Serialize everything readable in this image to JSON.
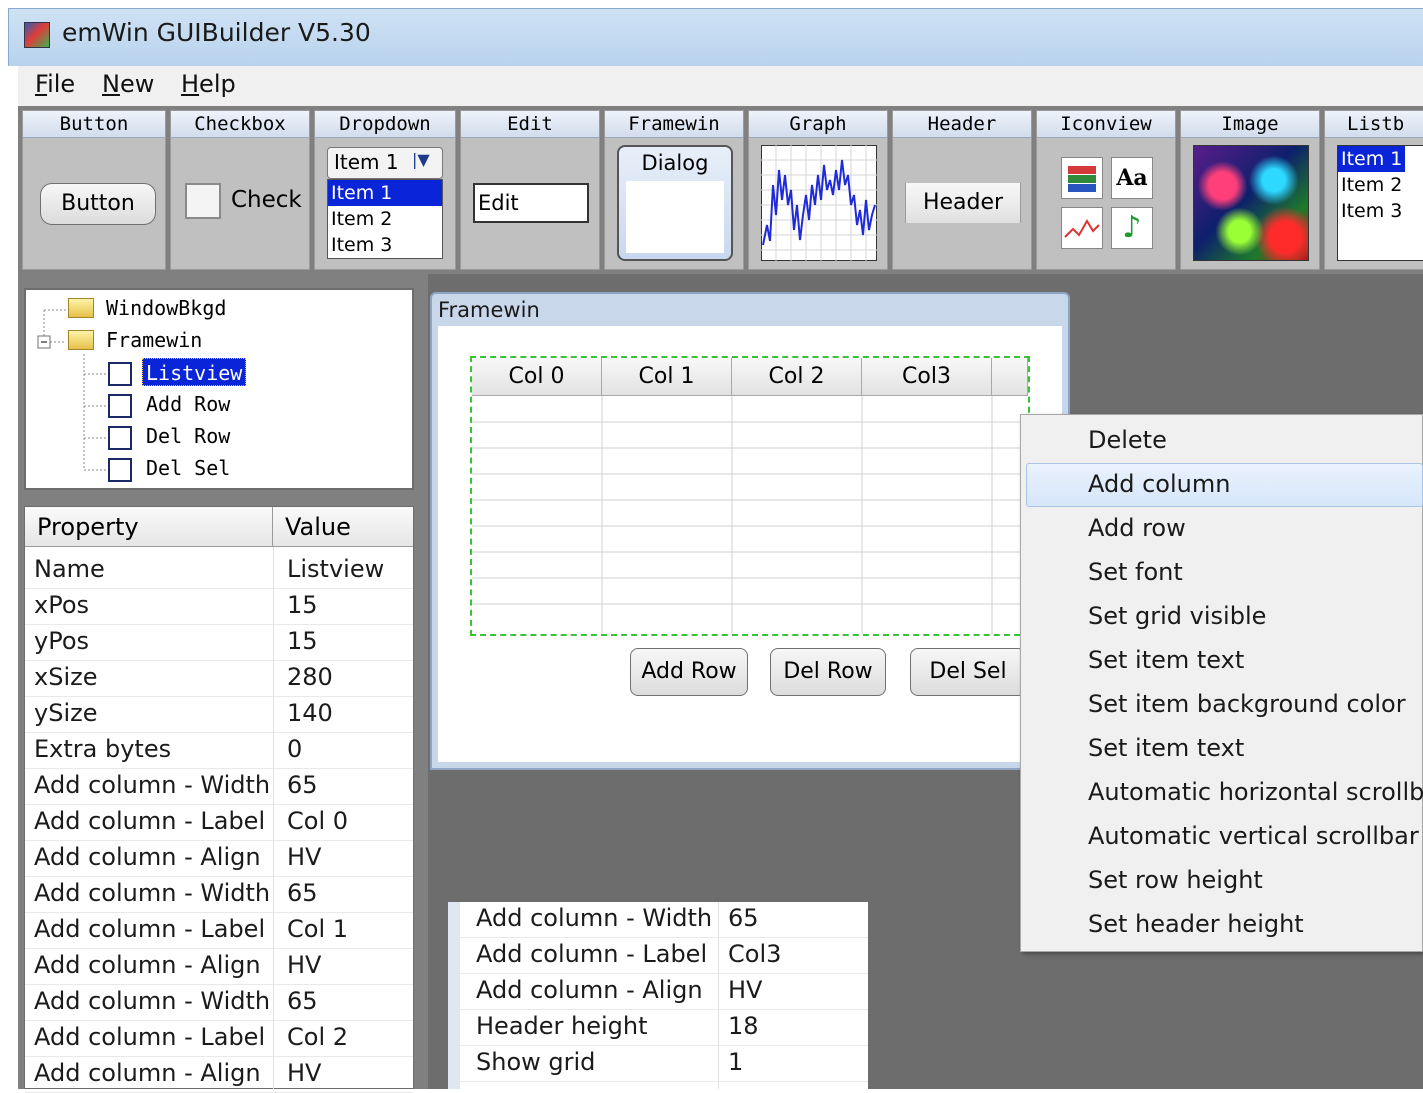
{
  "window": {
    "title": "emWin GUIBuilder V5.30"
  },
  "menu": [
    {
      "label": "File",
      "accel": "F",
      "rest": "ile"
    },
    {
      "label": "New",
      "accel": "N",
      "rest": "ew"
    },
    {
      "label": "Help",
      "accel": "H",
      "rest": "elp"
    }
  ],
  "palette": {
    "button": {
      "header": "Button",
      "widget_label": "Button"
    },
    "checkbox": {
      "header": "Checkbox",
      "widget_label": "Check"
    },
    "dropdown": {
      "header": "Dropdown",
      "selected": "Item 1",
      "items": [
        "Item 1",
        "Item 2",
        "Item 3"
      ]
    },
    "edit": {
      "header": "Edit",
      "widget_label": "Edit"
    },
    "framewin": {
      "header": "Framewin",
      "widget_label": "Dialog"
    },
    "graph": {
      "header": "Graph"
    },
    "header": {
      "header": "Header",
      "widget_label": "Header"
    },
    "iconview": {
      "header": "Iconview",
      "font_icon": "Aa"
    },
    "image": {
      "header": "Image"
    },
    "listbox": {
      "header": "Listb",
      "items": [
        "Item 1",
        "Item 2",
        "Item 3"
      ]
    }
  },
  "tree": [
    {
      "label": "WindowBkgd",
      "kind": "folder"
    },
    {
      "label": "Framewin",
      "kind": "folder"
    },
    {
      "label": "Listview",
      "kind": "widget",
      "selected": true
    },
    {
      "label": "Add Row",
      "kind": "widget"
    },
    {
      "label": "Del Row",
      "kind": "widget"
    },
    {
      "label": "Del Sel",
      "kind": "widget"
    }
  ],
  "properties": {
    "header_property": "Property",
    "header_value": "Value",
    "rows": [
      {
        "name": "Name",
        "value": "Listview"
      },
      {
        "name": "xPos",
        "value": "15"
      },
      {
        "name": "yPos",
        "value": "15"
      },
      {
        "name": "xSize",
        "value": "280"
      },
      {
        "name": "ySize",
        "value": "140"
      },
      {
        "name": "Extra bytes",
        "value": "0"
      },
      {
        "name": "Add column - Width",
        "value": "65"
      },
      {
        "name": "Add column - Label",
        "value": "Col 0"
      },
      {
        "name": "Add column - Align",
        "value": "HV"
      },
      {
        "name": "Add column - Width",
        "value": "65"
      },
      {
        "name": "Add column - Label",
        "value": "Col 1"
      },
      {
        "name": "Add column - Align",
        "value": "HV"
      },
      {
        "name": "Add column - Width",
        "value": "65"
      },
      {
        "name": "Add column - Label",
        "value": "Col 2"
      },
      {
        "name": "Add column - Align",
        "value": "HV"
      }
    ]
  },
  "properties_continued": [
    {
      "name": "Add column - Width",
      "value": "65"
    },
    {
      "name": "Add column - Label",
      "value": "Col3"
    },
    {
      "name": "Add column - Align",
      "value": "HV"
    },
    {
      "name": "Header height",
      "value": "18"
    },
    {
      "name": "Show grid",
      "value": "1"
    }
  ],
  "framewin": {
    "title": "Framewin",
    "listview_columns": [
      "Col 0",
      "Col 1",
      "Col 2",
      "Col3"
    ],
    "buttons": [
      "Add Row",
      "Del Row",
      "Del Sel"
    ]
  },
  "context_menu": {
    "highlighted": "Add column",
    "items": [
      "Delete",
      "Add column",
      "Add row",
      "Set font",
      "Set grid visible",
      "Set item text",
      "Set item background color",
      "Set item text",
      "Automatic horizontal scrollb",
      "Automatic vertical scrollbar",
      "Set row height",
      "Set header height"
    ]
  },
  "colors": {
    "selection": "#0a24d8",
    "canvas": "#6d6d6d",
    "palette_bg": "#808080",
    "listview_grid": "#37c237",
    "graph_line": "#1f2bd8"
  }
}
